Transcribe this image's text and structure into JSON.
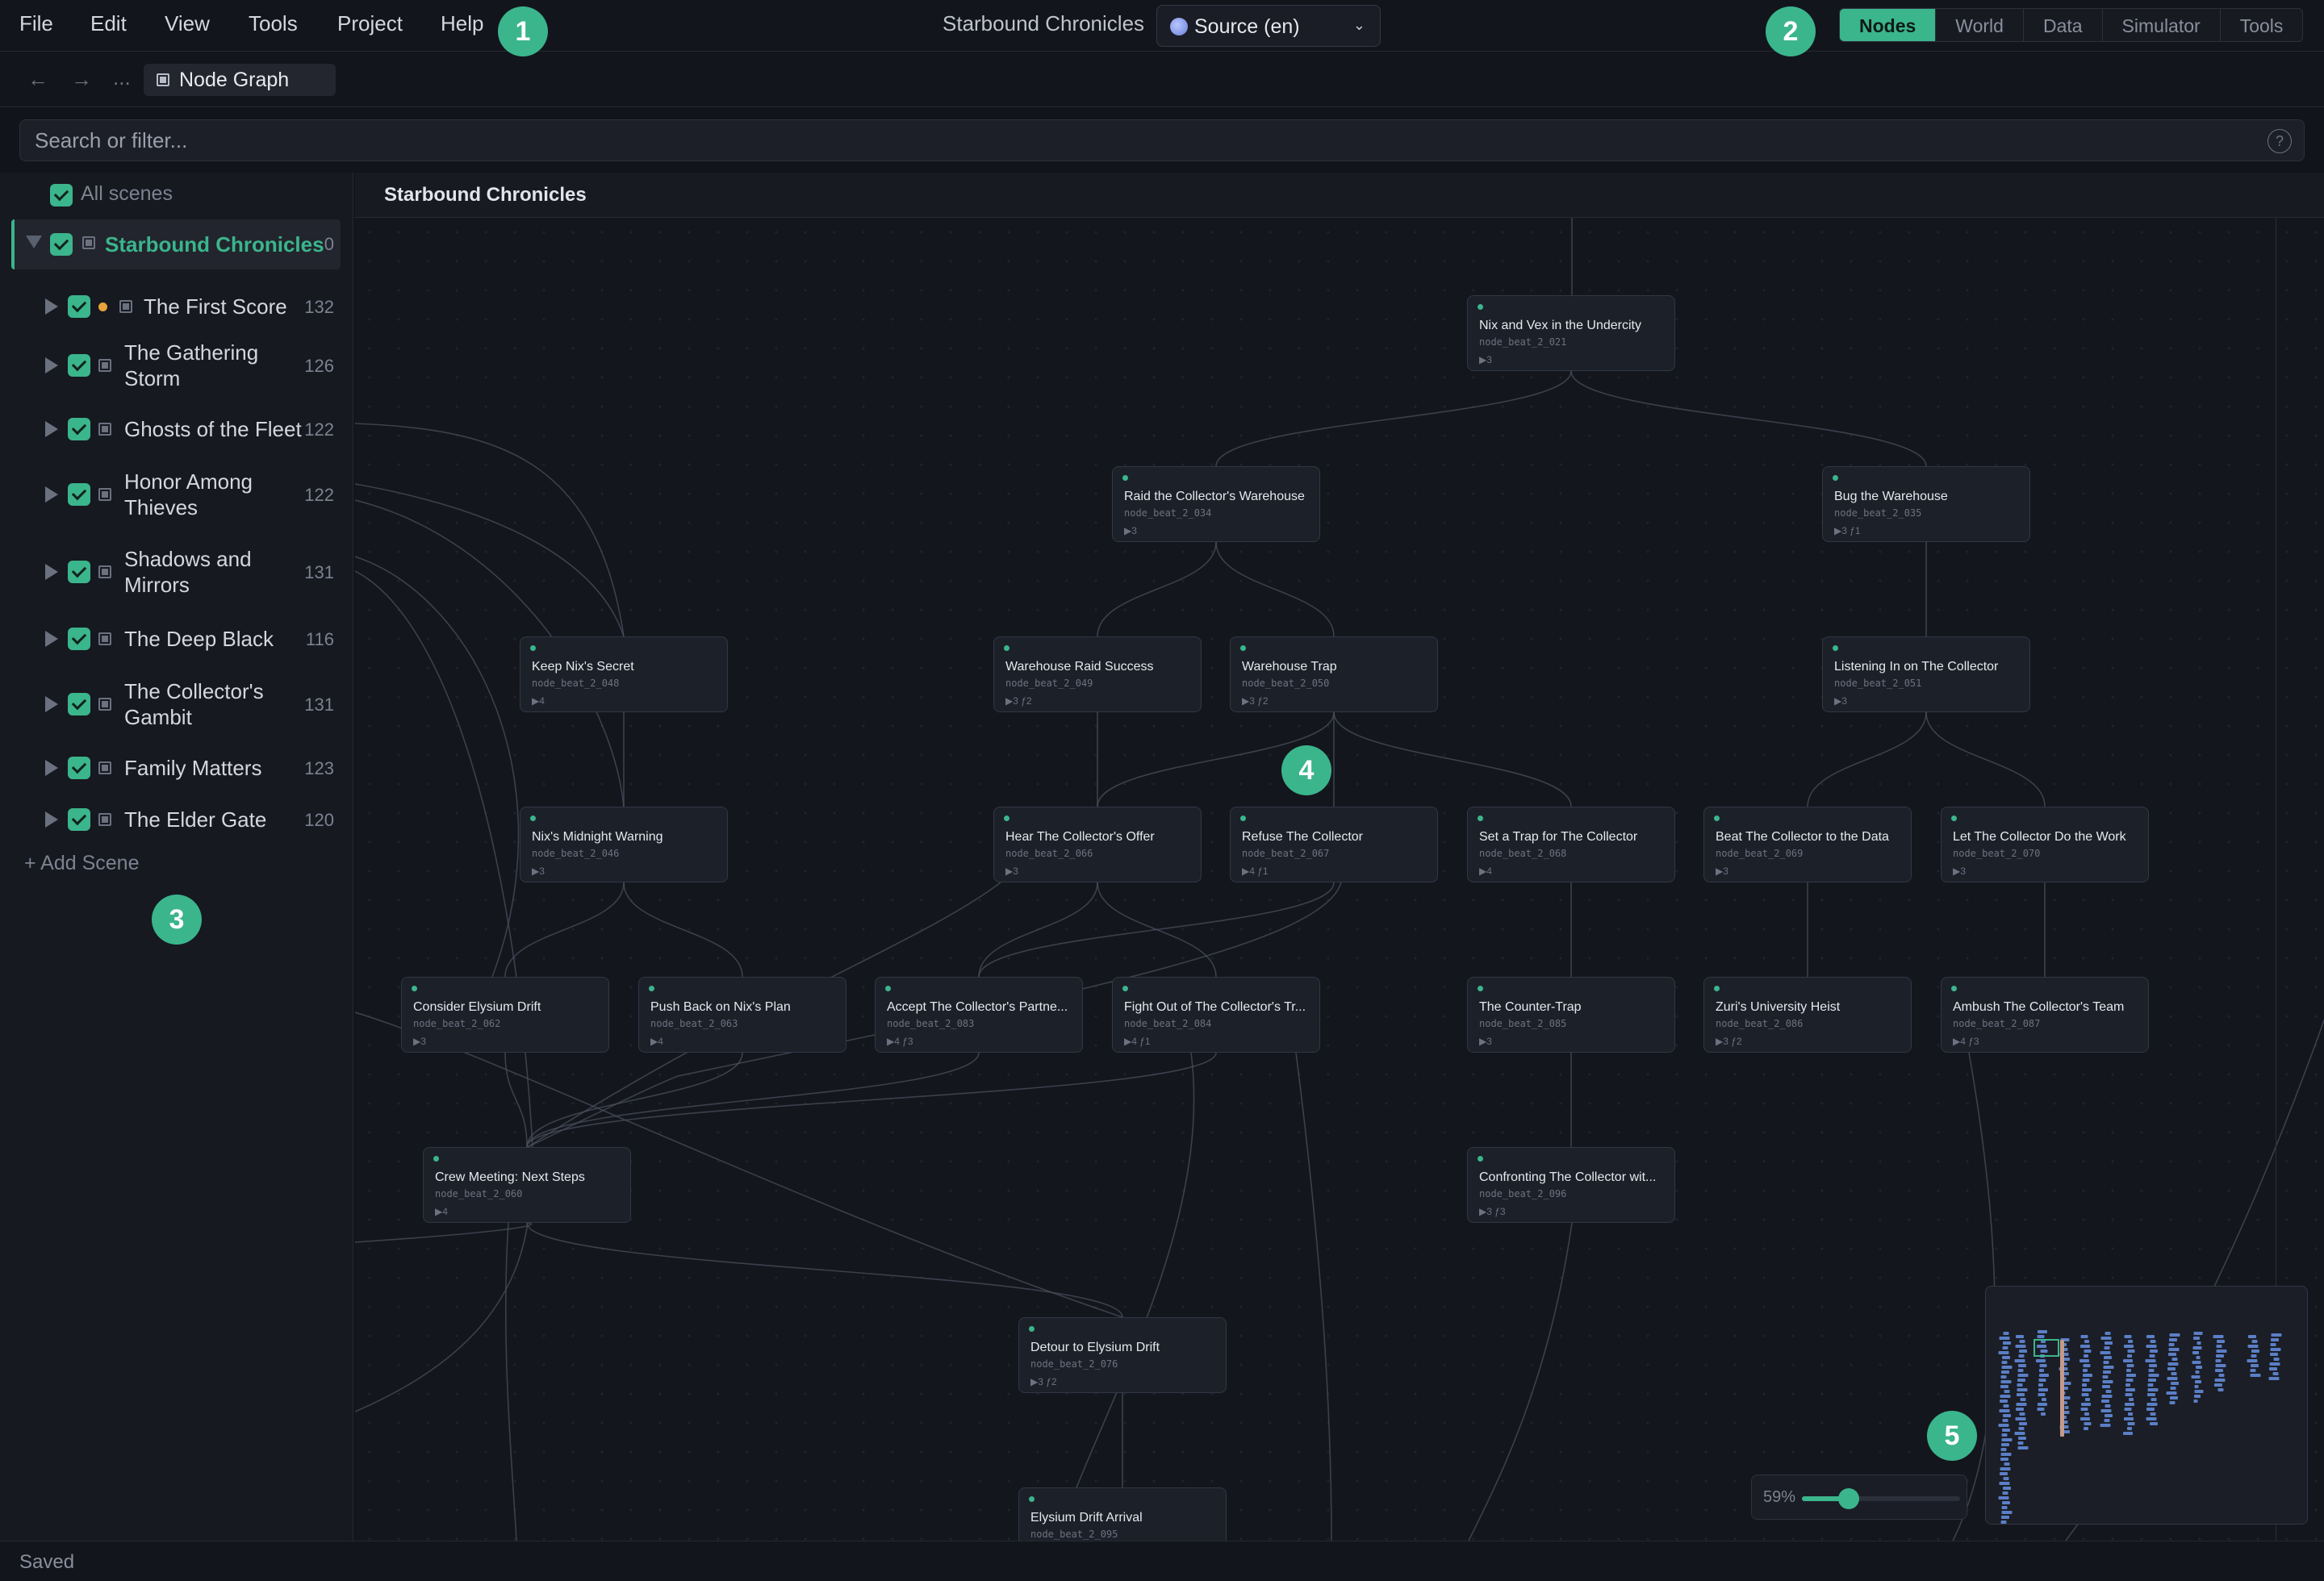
{
  "menu": [
    "File",
    "Edit",
    "View",
    "Tools",
    "Project",
    "Help"
  ],
  "app_title": "Starbound Chronicles",
  "locale": {
    "label": "Source (en)",
    "icon": "globe-icon"
  },
  "mode_tabs": [
    {
      "label": "Nodes",
      "active": true
    },
    {
      "label": "World",
      "active": false
    },
    {
      "label": "Data",
      "active": false
    },
    {
      "label": "Simulator",
      "active": false
    },
    {
      "label": "Tools",
      "active": false
    }
  ],
  "toolbar": {
    "back_icon": "←",
    "forward_icon": "→",
    "more": "...",
    "breadcrumb": "Node Graph"
  },
  "search": {
    "placeholder": "Search or filter...",
    "help_icon": "?"
  },
  "sidebar": {
    "all_scenes": "All scenes",
    "root": {
      "name": "Starbound Chronicles",
      "count": "0"
    },
    "scenes": [
      {
        "name": "The First Score",
        "count": "132",
        "unsaved": true
      },
      {
        "name": "The Gathering Storm",
        "count": "126"
      },
      {
        "name": "Ghosts of the Fleet",
        "count": "122"
      },
      {
        "name": "Honor Among Thieves",
        "count": "122"
      },
      {
        "name": "Shadows and Mirrors",
        "count": "131"
      },
      {
        "name": "The Deep Black",
        "count": "116"
      },
      {
        "name": "The Collector's Gambit",
        "count": "131"
      },
      {
        "name": "Family Matters",
        "count": "123"
      },
      {
        "name": "The Elder Gate",
        "count": "120"
      }
    ],
    "add_scene": "+ Add Scene"
  },
  "canvas": {
    "title": "Starbound Chronicles",
    "nodes": [
      {
        "key": "n021",
        "title": "Nix and Vex in the Undercity",
        "id": "node_beat_2_021",
        "stats": "▶3"
      },
      {
        "key": "n034",
        "title": "Raid the Collector's Warehouse",
        "id": "node_beat_2_034",
        "stats": "▶3"
      },
      {
        "key": "n035",
        "title": "Bug the Warehouse",
        "id": "node_beat_2_035",
        "stats": "▶3  ƒ1"
      },
      {
        "key": "n048",
        "title": "Keep Nix's Secret",
        "id": "node_beat_2_048",
        "stats": "▶4"
      },
      {
        "key": "n049",
        "title": "Warehouse Raid Success",
        "id": "node_beat_2_049",
        "stats": "▶3  ƒ2"
      },
      {
        "key": "n050",
        "title": "Warehouse Trap",
        "id": "node_beat_2_050",
        "stats": "▶3  ƒ2"
      },
      {
        "key": "n051",
        "title": "Listening In on The Collector",
        "id": "node_beat_2_051",
        "stats": "▶3"
      },
      {
        "key": "n046",
        "title": "Nix's Midnight Warning",
        "id": "node_beat_2_046",
        "stats": "▶3"
      },
      {
        "key": "n066",
        "title": "Hear The Collector's Offer",
        "id": "node_beat_2_066",
        "stats": "▶3"
      },
      {
        "key": "n067",
        "title": "Refuse The Collector",
        "id": "node_beat_2_067",
        "stats": "▶4  ƒ1"
      },
      {
        "key": "n068",
        "title": "Set a Trap for The Collector",
        "id": "node_beat_2_068",
        "stats": "▶4"
      },
      {
        "key": "n069",
        "title": "Beat The Collector to the Data",
        "id": "node_beat_2_069",
        "stats": "▶3"
      },
      {
        "key": "n070",
        "title": "Let The Collector Do the Work",
        "id": "node_beat_2_070",
        "stats": "▶3"
      },
      {
        "key": "n062",
        "title": "Consider Elysium Drift",
        "id": "node_beat_2_062",
        "stats": "▶3"
      },
      {
        "key": "n063",
        "title": "Push Back on Nix's Plan",
        "id": "node_beat_2_063",
        "stats": "▶4"
      },
      {
        "key": "n083",
        "title": "Accept The Collector's Partne...",
        "id": "node_beat_2_083",
        "stats": "▶4  ƒ3"
      },
      {
        "key": "n084",
        "title": "Fight Out of The Collector's Tr...",
        "id": "node_beat_2_084",
        "stats": "▶4  ƒ1"
      },
      {
        "key": "n085",
        "title": "The Counter-Trap",
        "id": "node_beat_2_085",
        "stats": "▶3"
      },
      {
        "key": "n086",
        "title": "Zuri's University Heist",
        "id": "node_beat_2_086",
        "stats": "▶3  ƒ2"
      },
      {
        "key": "n087",
        "title": "Ambush The Collector's Team",
        "id": "node_beat_2_087",
        "stats": "▶4  ƒ3"
      },
      {
        "key": "n060",
        "title": "Crew Meeting: Next Steps",
        "id": "node_beat_2_060",
        "stats": "▶4"
      },
      {
        "key": "n096",
        "title": "Confronting The Collector wit...",
        "id": "node_beat_2_096",
        "stats": "▶3  ƒ3"
      },
      {
        "key": "n076",
        "title": "Detour to Elysium Drift",
        "id": "node_beat_2_076",
        "stats": "▶3  ƒ2"
      },
      {
        "key": "n095",
        "title": "Elysium Drift Arrival",
        "id": "node_beat_2_095",
        "stats": ""
      }
    ]
  },
  "zoom": {
    "label": "59%",
    "value": 0.59
  },
  "annotations": [
    "1",
    "2",
    "3",
    "4",
    "5"
  ],
  "status": "Saved",
  "colors": {
    "accent": "#3bb58c",
    "background": "#12141b",
    "panel": "#161920",
    "node": "#1c2029",
    "edge": "#4a4f5c",
    "unsaved_dot": "#e8a43a"
  }
}
